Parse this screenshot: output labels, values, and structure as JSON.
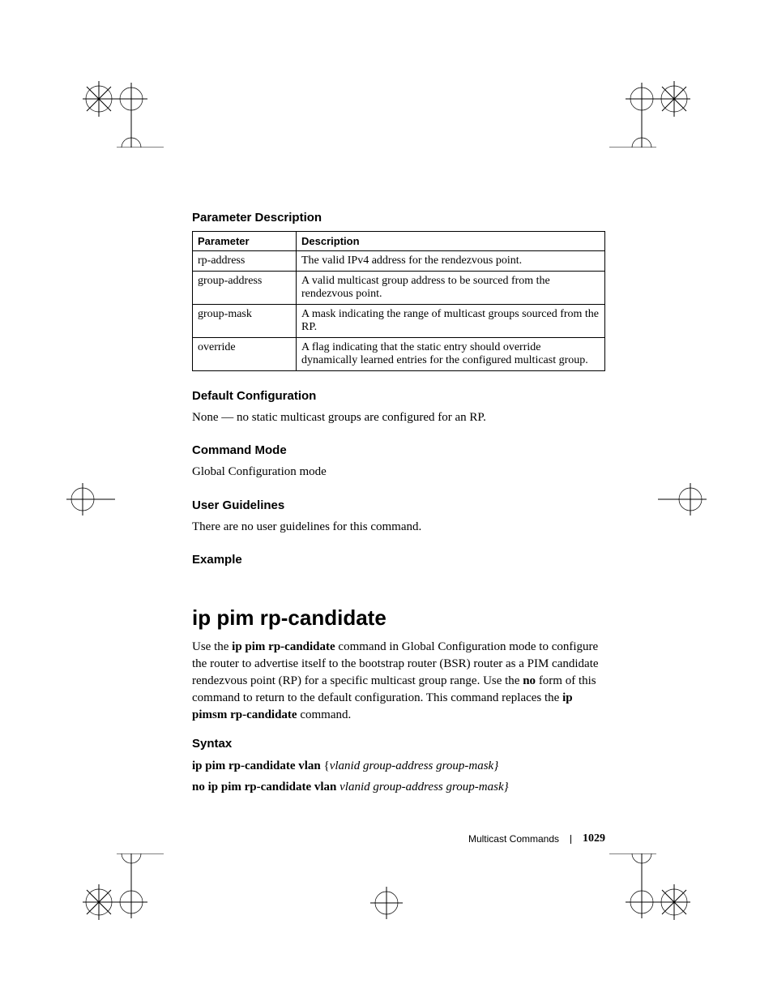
{
  "section1": {
    "heading": "Parameter Description",
    "table": {
      "headers": [
        "Parameter",
        "Description"
      ],
      "rows": [
        {
          "param": "rp-address",
          "desc": "The valid IPv4 address for the rendezvous point."
        },
        {
          "param": "group-address",
          "desc": "A valid multicast group address to be sourced from the rendezvous point."
        },
        {
          "param": "group-mask",
          "desc": "A mask indicating the range of multicast groups sourced from the RP."
        },
        {
          "param": "override",
          "desc": "A flag indicating that the static entry should override dynamically learned entries for the configured multicast group."
        }
      ]
    }
  },
  "section2": {
    "heading": "Default Configuration",
    "text": "None — no static multicast groups are configured for an RP."
  },
  "section3": {
    "heading": "Command Mode",
    "text": "Global Configuration mode"
  },
  "section4": {
    "heading": "User Guidelines",
    "text": "There are no user guidelines for this command."
  },
  "section5": {
    "heading": "Example"
  },
  "command": {
    "title": "ip pim rp-candidate",
    "desc_prefix": "Use the ",
    "desc_bold1": "ip pim rp-candidate",
    "desc_mid1": " command in Global Configuration mode to configure the router to advertise itself to the bootstrap router (BSR) router as a PIM candidate rendezvous point (RP) for a specific multicast group range. Use the ",
    "desc_bold2": "no",
    "desc_mid2": " form of this command to return to the default configuration. This command replaces the ",
    "desc_bold3": "ip pimsm rp-candidate",
    "desc_suffix": " command."
  },
  "syntax": {
    "heading": "Syntax",
    "line1_bold": "ip pim rp-candidate vlan ",
    "line1_brace_open": "{",
    "line1_italic": "vlanid group-address group-mask}",
    "line2_bold": "no ip pim rp-candidate vlan ",
    "line2_italic": "vlanid group-address group-mask}"
  },
  "footer": {
    "label": "Multicast Commands",
    "page": "1029"
  }
}
